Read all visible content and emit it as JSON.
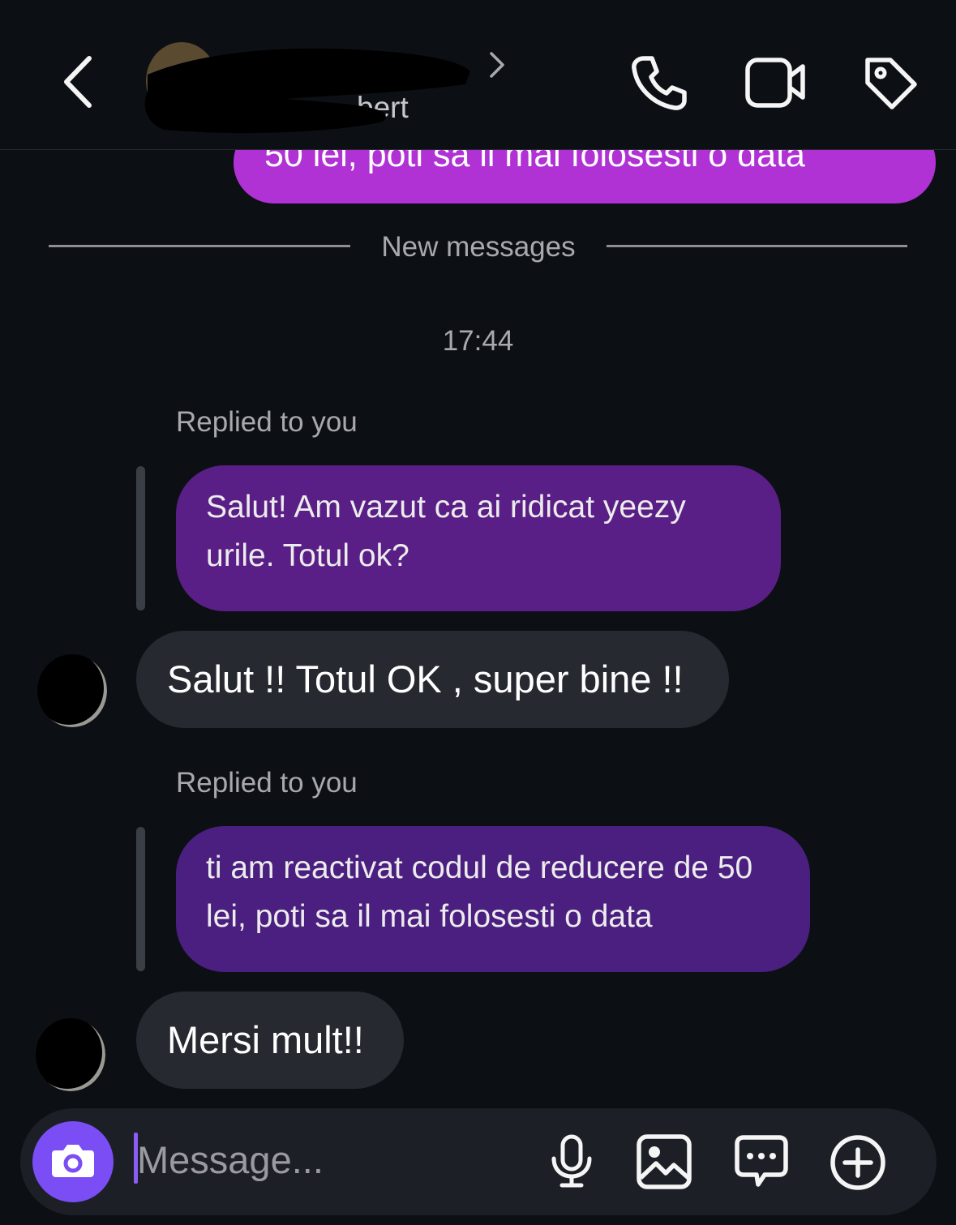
{
  "header": {
    "subtitle_visible": "bert",
    "icons": [
      "back-chevron-icon",
      "chevron-right-icon",
      "phone-icon",
      "video-icon",
      "tag-icon"
    ]
  },
  "thread": {
    "previous_outgoing_partial": "50 lei, poti sa il mai folosesti o data",
    "divider_label": "New messages",
    "timestamp": "17:44",
    "replies": [
      {
        "label": "Replied to you",
        "quoted": "Salut! Am vazut ca ai ridicat yeezy urile. Totul ok?",
        "reply_text": "Salut !! Totul OK , super bine !!"
      },
      {
        "label": "Replied to you",
        "quoted": "ti am reactivat codul de reducere de 50 lei, poti sa il mai folosesti o data",
        "reply_text": "Mersi mult!!"
      }
    ]
  },
  "composer": {
    "placeholder": "Message...",
    "icons": [
      "camera-icon",
      "microphone-icon",
      "gallery-icon",
      "sticker-chat-icon",
      "add-icon"
    ]
  },
  "colors": {
    "background": "#0c1014",
    "outgoing_bubble": "#b031d4",
    "quoted_bubble_1": "#5a1f86",
    "quoted_bubble_2": "#4a1f80",
    "incoming_bubble": "#262a30",
    "camera_button": "#7b4df5"
  }
}
